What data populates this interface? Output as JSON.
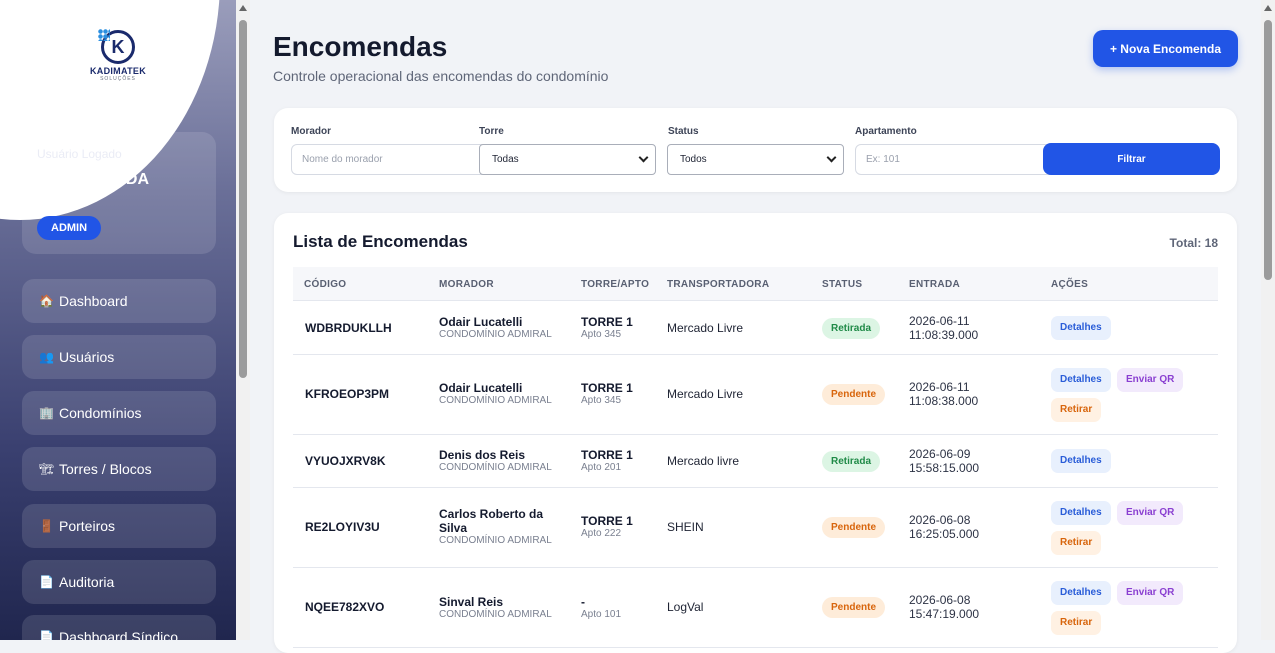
{
  "sidebar": {
    "logo_name": "KADIMATEK",
    "logo_sub": "SOLUÇÕES",
    "user_label": "Usuário Logado",
    "user_name": "HENRIQUE DA SILVA",
    "role": "ADMIN",
    "items": [
      {
        "label": "Dashboard",
        "icon": "house-icon"
      },
      {
        "label": "Usuários",
        "icon": "users-icon"
      },
      {
        "label": "Condomínios",
        "icon": "building-icon"
      },
      {
        "label": "Torres / Blocos",
        "icon": "crane-icon"
      },
      {
        "label": "Porteiros",
        "icon": "door-icon"
      },
      {
        "label": "Auditoria",
        "icon": "document-icon"
      },
      {
        "label": "Dashboard Síndico",
        "icon": "document-icon"
      }
    ]
  },
  "header": {
    "title": "Encomendas",
    "subtitle": "Controle operacional das encomendas do condomínio",
    "new_button": "+ Nova Encomenda"
  },
  "filters": {
    "morador_label": "Morador",
    "morador_placeholder": "Nome do morador",
    "torre_label": "Torre",
    "torre_value": "Todas",
    "status_label": "Status",
    "status_value": "Todos",
    "apto_label": "Apartamento",
    "apto_placeholder": "Ex: 101",
    "filter_button": "Filtrar"
  },
  "list": {
    "title": "Lista de Encomendas",
    "total": "Total: 18",
    "columns": [
      "CÓDIGO",
      "MORADOR",
      "TORRE/APTO",
      "TRANSPORTADORA",
      "STATUS",
      "ENTRADA",
      "AÇÕES"
    ],
    "rows": [
      {
        "code": "WDBRDUKLLH",
        "name": "Odair Lucatelli",
        "cond": "CONDOMÍNIO ADMIRAL",
        "torre": "TORRE 1",
        "apto": "Apto 345",
        "transp": "Mercado Livre",
        "status": "Retirada",
        "date": "2026-06-11",
        "time": "11:08:39.000",
        "actions": [
          "Detalhes"
        ]
      },
      {
        "code": "KFROEOP3PM",
        "name": "Odair Lucatelli",
        "cond": "CONDOMÍNIO ADMIRAL",
        "torre": "TORRE 1",
        "apto": "Apto 345",
        "transp": "Mercado Livre",
        "status": "Pendente",
        "date": "2026-06-11",
        "time": "11:08:38.000",
        "actions": [
          "Detalhes",
          "Enviar QR",
          "Retirar"
        ]
      },
      {
        "code": "VYUOJXRV8K",
        "name": "Denis dos Reis",
        "cond": "CONDOMÍNIO ADMIRAL",
        "torre": "TORRE 1",
        "apto": "Apto 201",
        "transp": "Mercado livre",
        "status": "Retirada",
        "date": "2026-06-09",
        "time": "15:58:15.000",
        "actions": [
          "Detalhes"
        ]
      },
      {
        "code": "RE2LOYIV3U",
        "name": "Carlos Roberto da Silva",
        "cond": "CONDOMÍNIO ADMIRAL",
        "torre": "TORRE 1",
        "apto": "Apto 222",
        "transp": "SHEIN",
        "status": "Pendente",
        "date": "2026-06-08",
        "time": "16:25:05.000",
        "actions": [
          "Detalhes",
          "Enviar QR",
          "Retirar"
        ]
      },
      {
        "code": "NQEE782XVO",
        "name": "Sinval Reis",
        "cond": "CONDOMÍNIO ADMIRAL",
        "torre": "-",
        "apto": "Apto 101",
        "transp": "LogVal",
        "status": "Pendente",
        "date": "2026-06-08",
        "time": "15:47:19.000",
        "actions": [
          "Detalhes",
          "Enviar QR",
          "Retirar"
        ]
      }
    ]
  }
}
